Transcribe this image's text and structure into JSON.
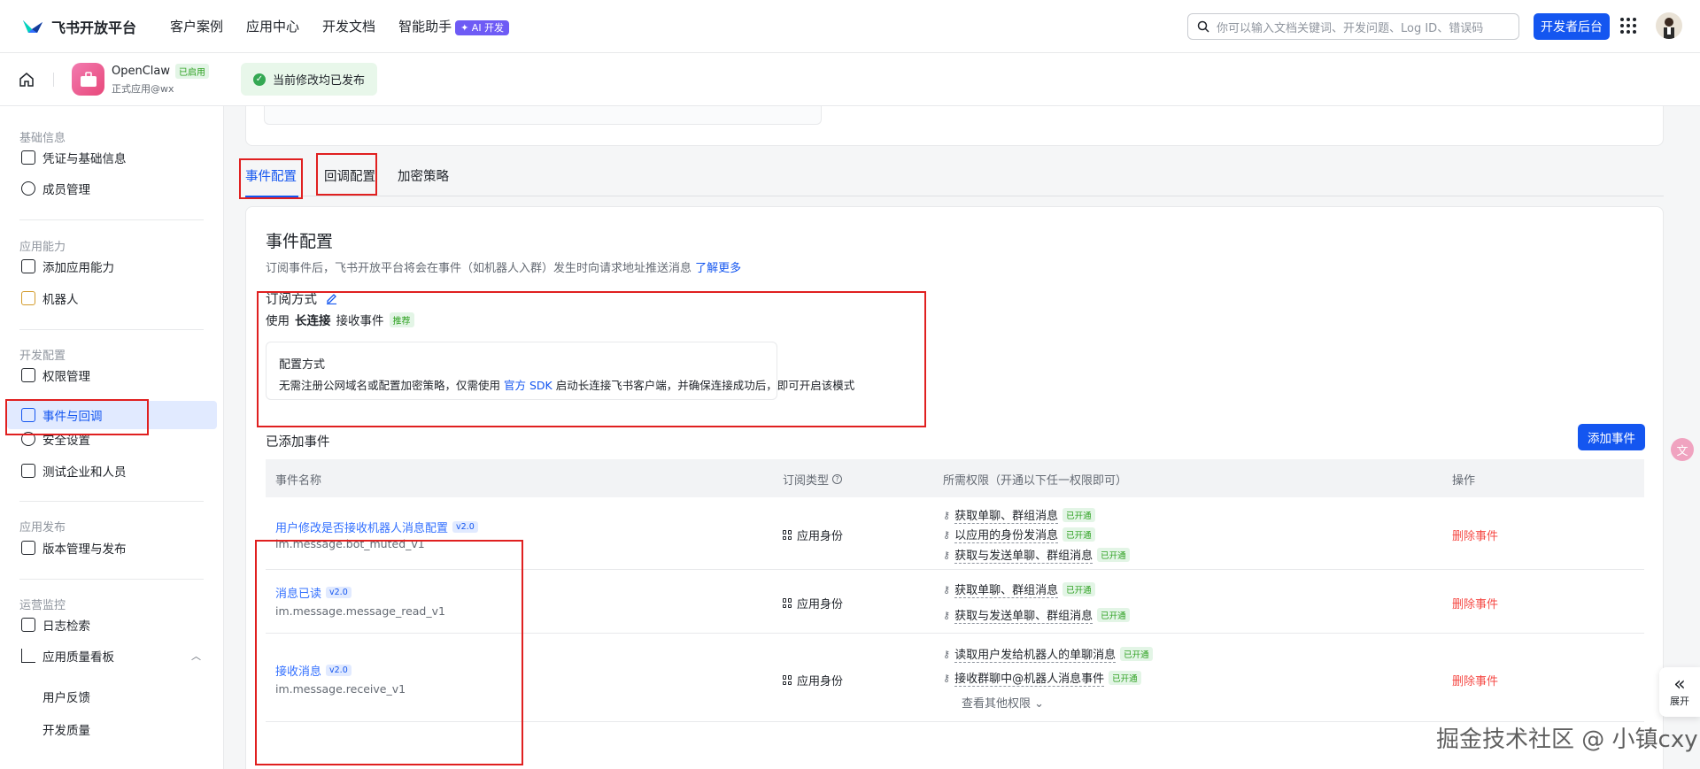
{
  "topnav": {
    "logo": "飞书开放平台",
    "links": [
      "客户案例",
      "应用中心",
      "开发文档",
      "智能助手"
    ],
    "ai_badge": "✦ AI 开发",
    "search_placeholder": "你可以输入文档关键词、开发问题、Log ID、错误码",
    "dev_console": "开发者后台"
  },
  "app": {
    "name": "OpenClaw",
    "status": "已启用",
    "sub": "正式应用@wx",
    "published": "当前修改均已发布"
  },
  "sidebar": {
    "groups": [
      "基础信息",
      "应用能力",
      "开发配置",
      "应用发布",
      "运营监控"
    ],
    "items": [
      "凭证与基础信息",
      "成员管理",
      "添加应用能力",
      "机器人",
      "权限管理",
      "事件与回调",
      "安全设置",
      "测试企业和人员",
      "版本管理与发布",
      "日志检索",
      "应用质量看板"
    ],
    "subitems": [
      "用户反馈",
      "开发质量"
    ]
  },
  "tabs": [
    "事件配置",
    "回调配置",
    "加密策略"
  ],
  "event_config": {
    "title": "事件配置",
    "desc": "订阅事件后，飞书开放平台将会在事件（如机器人入群）发生时向请求地址推送消息",
    "learn_more": "了解更多",
    "sub_title": "订阅方式",
    "use_prefix": "使用",
    "use_mode": "长连接",
    "use_suffix": "接收事件",
    "recommend": "推荐",
    "mode_title": "配置方式",
    "mode_desc_1": "无需注册公网域名或配置加密策略，仅需使用",
    "mode_sdk": "官方 SDK",
    "mode_desc_2": "启动长连接飞书客户端，并确保连接成功后，即可开启该模式",
    "added_title": "已添加事件",
    "add_button": "添加事件"
  },
  "table": {
    "headers": [
      "事件名称",
      "订阅类型",
      "所需权限（开通以下任一权限即可）",
      "操作"
    ],
    "rows": [
      {
        "name": "用户修改是否接收机器人消息配置",
        "version": "v2.0",
        "code": "im.message.bot_muted_v1",
        "identity": "应用身份",
        "perms": [
          "获取单聊、群组消息",
          "以应用的身份发消息",
          "获取与发送单聊、群组消息"
        ],
        "action": "删除事件"
      },
      {
        "name": "消息已读",
        "version": "v2.0",
        "code": "im.message.message_read_v1",
        "identity": "应用身份",
        "perms": [
          "获取单聊、群组消息",
          "获取与发送单聊、群组消息"
        ],
        "action": "删除事件"
      },
      {
        "name": "接收消息",
        "version": "v2.0",
        "code": "im.message.receive_v1",
        "identity": "应用身份",
        "perms": [
          "读取用户发给机器人的单聊消息",
          "接收群聊中@机器人消息事件"
        ],
        "action": "删除事件",
        "more": "查看其他权限 ⌄"
      }
    ],
    "opened_label": "已开通"
  },
  "expand_label": "展开",
  "watermark": "掘金技术社区 @ 小镇cxy"
}
